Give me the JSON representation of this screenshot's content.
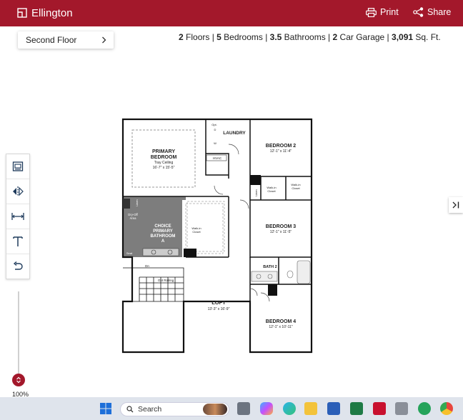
{
  "header": {
    "title": "Ellington",
    "print_label": "Print",
    "share_label": "Share",
    "accent_color": "#a3182b"
  },
  "floor_selector": {
    "selected": "Second Floor"
  },
  "summary": {
    "floors_n": "2",
    "floors_t": " Floors | ",
    "bed_n": "5",
    "bed_t": " Bedrooms | ",
    "bath_n": "3.5",
    "bath_t": " Bathrooms | ",
    "garage_n": "2",
    "garage_t": " Car Garage | ",
    "sqft_n": "3,091",
    "sqft_t": " Sq. Ft."
  },
  "toolbar": {
    "tools": [
      "furniture-icon",
      "mirror-icon",
      "measure-icon",
      "text-icon",
      "undo-icon"
    ]
  },
  "zoom": {
    "label": "100%"
  },
  "floorplan": {
    "laundry": "LAUNDRY",
    "opt_top": "Opt.",
    "opt_d": "D",
    "opt_w": "W",
    "hvac": "HVAC",
    "primary_1": "PRIMARY",
    "primary_2": "BEDROOM",
    "primary_sub": "Tray Ceiling",
    "primary_dim": "16'-7\" x 15'-5\"",
    "bed2": "BEDROOM 2",
    "bed2_dim": "12'-1\" x 11'-4\"",
    "linen1": "Linen",
    "walkin1": "Walk-in",
    "closet1": "Closet",
    "walkin2": "Walk-in",
    "closet2": "Closet",
    "linen2": "Linen",
    "dry_off_1": "Dry-Off",
    "dry_off_2": "Area",
    "choice_1": "CHOICE",
    "choice_2": "PRIMARY",
    "choice_3": "BATHROOM",
    "choice_4": "A",
    "walkin3": "Walk-in",
    "closet3": "Closet",
    "seat": "Seat",
    "bed3": "BEDROOM 3",
    "bed3_dim": "12'-1\" x 11'-5\"",
    "dn": "Dn",
    "opt_railing": "Opt Railing",
    "bath2": "BATH 2",
    "loft": "LOFT",
    "loft_dim": "13'-3\" x 16'-9\"",
    "bed4": "BEDROOM 4",
    "bed4_dim": "12'-1\" x 10'-11\""
  },
  "taskbar": {
    "search_placeholder": "Search"
  }
}
